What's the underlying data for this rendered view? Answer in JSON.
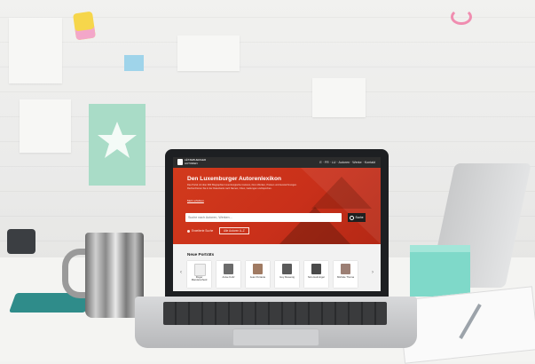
{
  "site": {
    "logo_text": "LËTZEBUERGER AUTOREN",
    "header_links": "E · FR · LU · Autoren · Werke · Kontakt",
    "hero": {
      "title": "Den Luxemburger Autorenlexikon",
      "description": "Das Portal mit über 900 Biographien luxemburgischer Autoren, ihren Werken, Preisen und Auszeichnungen. Recherchieren Sie in der Datenbank nach Namen, Orten, Gattungen und Epochen.",
      "more_link": "Mehr erfahren",
      "search_placeholder": "Suche nach Autoren, Werken…",
      "search_button": "Suche",
      "action_1": "Erweiterte Suche",
      "action_2": "Alle Autoren A–Z"
    },
    "featured": {
      "title": "Neue Porträts",
      "authors": [
        {
          "name": "Roger Manderscheid",
          "has_photo": false
        },
        {
          "name": "Anise Koltz",
          "has_photo": true
        },
        {
          "name": "Jean Portante",
          "has_photo": true
        },
        {
          "name": "Guy Rewenig",
          "has_photo": true
        },
        {
          "name": "Nico Helminger",
          "has_photo": true
        },
        {
          "name": "Michèle Thoma",
          "has_photo": true
        }
      ]
    }
  }
}
